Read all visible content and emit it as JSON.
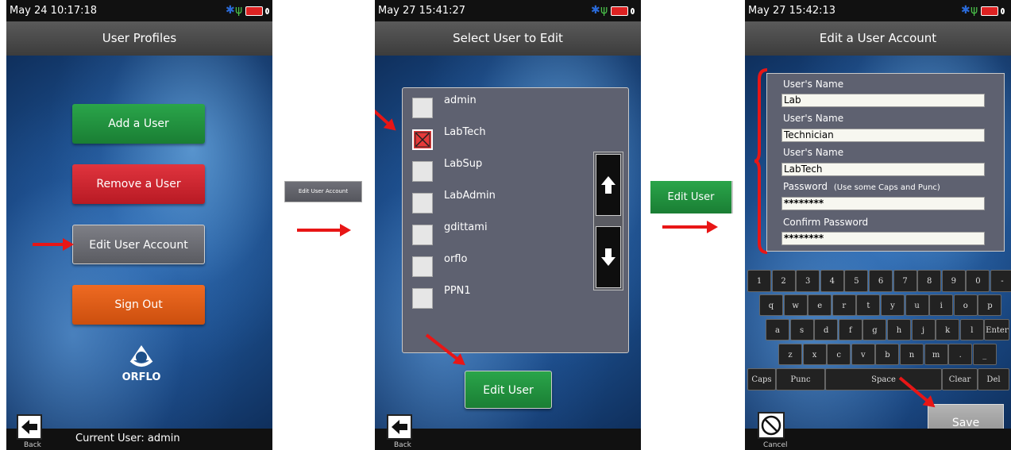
{
  "screen1": {
    "status_time": "May 24 10:17:18",
    "title": "User Profiles",
    "buttons": [
      "Add a User",
      "Remove a User",
      "Edit User Account",
      "Sign Out"
    ],
    "logo_text": "ORFLO",
    "back_label": "Back",
    "current_user": "Current User: admin"
  },
  "callout1": {
    "label": "Edit User Account"
  },
  "screen2": {
    "status_time": "May 27 15:41:27",
    "title": "Select User to Edit",
    "users": [
      {
        "name": "admin",
        "checked": false
      },
      {
        "name": "LabTech",
        "checked": true
      },
      {
        "name": "LabSup",
        "checked": false
      },
      {
        "name": "LabAdmin",
        "checked": false
      },
      {
        "name": "gdittami",
        "checked": false
      },
      {
        "name": "orflo",
        "checked": false
      },
      {
        "name": "PPN1",
        "checked": false
      }
    ],
    "edit_button": "Edit User",
    "back_label": "Back"
  },
  "callout2": {
    "label": "Edit User"
  },
  "screen3": {
    "status_time": "May 27 15:42:13",
    "title": "Edit a User Account",
    "fields": [
      {
        "label": "User's Name",
        "value": "Lab"
      },
      {
        "label": "User's Name",
        "value": "Technician"
      },
      {
        "label": "User's Name",
        "value": "LabTech"
      },
      {
        "label": "Password",
        "value": "********"
      },
      {
        "label": "Confirm Password",
        "value": "********"
      }
    ],
    "password_hint": "(Use some Caps and Punc)",
    "keyboard": {
      "row1": [
        "1",
        "2",
        "3",
        "4",
        "5",
        "6",
        "7",
        "8",
        "9",
        "0",
        "-"
      ],
      "row2": [
        "q",
        "w",
        "e",
        "r",
        "t",
        "y",
        "u",
        "i",
        "o",
        "p"
      ],
      "row3": [
        "a",
        "s",
        "d",
        "f",
        "g",
        "h",
        "j",
        "k",
        "l",
        "Enter"
      ],
      "row4": [
        "z",
        "x",
        "c",
        "v",
        "b",
        "n",
        "m",
        ".",
        "_"
      ],
      "row5": [
        "Caps",
        "Punc",
        "Space",
        "Clear",
        "Del"
      ]
    },
    "save_button": "Save",
    "cancel_label": "Cancel"
  },
  "colors": {
    "accent_green": "#2aa54a",
    "accent_red": "#e0343e",
    "accent_orange": "#ee6a22",
    "arrow_red": "#e81616"
  }
}
